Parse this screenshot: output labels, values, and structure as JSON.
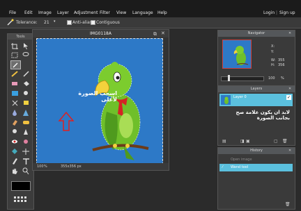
{
  "menubar": {
    "items": [
      "File",
      "Edit",
      "Image",
      "Layer",
      "Adjustment",
      "Filter",
      "View",
      "Language",
      "Help"
    ],
    "login": "Login",
    "sep": "|",
    "signup": "Sign up"
  },
  "tool_options": {
    "tolerance_label": "Tolerance:",
    "tolerance_value": "21",
    "antialias_label": "Anti-alias",
    "contiguous_label": "Contiguous"
  },
  "tools_panel": {
    "title": "Tools"
  },
  "document": {
    "title": "IMG0118A",
    "zoom": "100",
    "zoom_unit": "%",
    "size": "355x356 px",
    "annotation_arabic": "اسحب الصورة لأعلى"
  },
  "navigator": {
    "title": "Navigator",
    "x_label": "X:",
    "y_label": "Y:",
    "w_label": "W:",
    "w_value": "355",
    "h_label": "H:",
    "h_value": "356",
    "zoom_value": "100",
    "zoom_unit": "%"
  },
  "layers": {
    "title": "Layers",
    "layer_name": "Layer 0",
    "annotation_arabic": "لابد ان يكون علامة صح بجانب الصورة"
  },
  "history": {
    "title": "History",
    "items": [
      "Open image",
      "Wand tool"
    ]
  },
  "colors": {
    "canvas_bg": "#2d79c7",
    "accent": "#5bc0de",
    "arrow_red": "#e02020"
  }
}
